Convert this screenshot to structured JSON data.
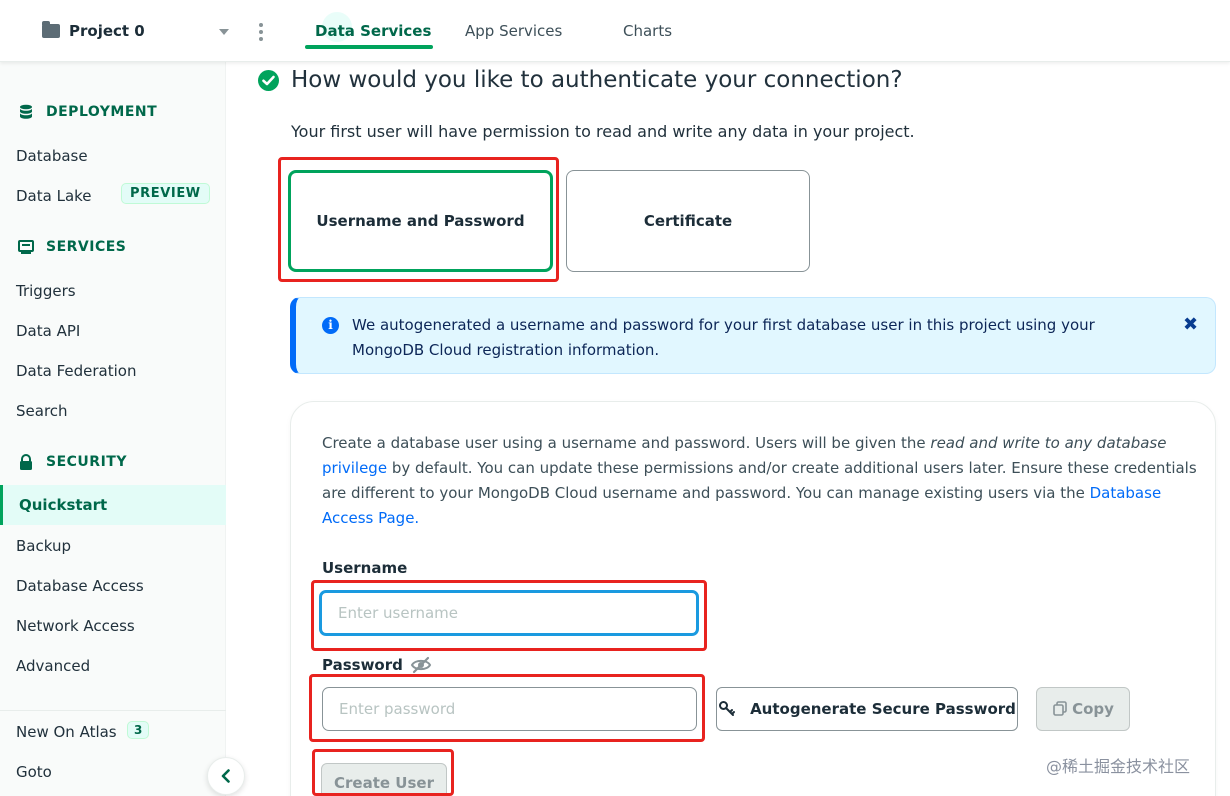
{
  "topbar": {
    "project_name": "Project 0",
    "tabs": [
      {
        "label": "Data Services",
        "active": true
      },
      {
        "label": "App Services",
        "active": false
      },
      {
        "label": "Charts",
        "active": false
      }
    ]
  },
  "sidebar": {
    "sections": [
      {
        "title": "DEPLOYMENT",
        "icon": "database-icon",
        "items": [
          "Database",
          "Data Lake"
        ]
      },
      {
        "title": "SERVICES",
        "icon": "services-icon",
        "items": [
          "Triggers",
          "Data API",
          "Data Federation",
          "Search"
        ]
      },
      {
        "title": "SECURITY",
        "icon": "lock-icon",
        "items": [
          "Quickstart",
          "Backup",
          "Database Access",
          "Network Access",
          "Advanced"
        ]
      }
    ],
    "preview_badge": "PREVIEW",
    "active_item": "Quickstart",
    "footer": {
      "new_on_atlas": "New On Atlas",
      "new_count": "3",
      "goto": "Goto"
    }
  },
  "main": {
    "heading": "How would you like to authenticate your connection?",
    "subtext": "Your first user will have permission to read and write any data in your project.",
    "options": [
      "Username and Password",
      "Certificate"
    ],
    "selected_option": "Username and Password",
    "banner": {
      "text": "We autogenerated a username and password for your first database user in this project using your MongoDB Cloud registration information.",
      "info_glyph": "i",
      "close_glyph": "✖"
    },
    "form": {
      "intro_1": "Create a database user using a username and password. Users will be given the ",
      "intro_italic": "read and write to any database",
      "intro_link_1": "privilege",
      "intro_2": " by default. You can update these permissions and/or create additional users later. Ensure these credentials are different to your MongoDB Cloud username and password. You can manage existing users via the ",
      "intro_link_2": "Database Access Page.",
      "username_label": "Username",
      "username_placeholder": "Enter username",
      "password_label": "Password",
      "password_placeholder": "Enter password",
      "autogen_button": "Autogenerate Secure Password",
      "copy_button": "Copy",
      "create_button": "Create User"
    }
  },
  "watermark": "@稀土掘金技术社区",
  "colors": {
    "brand_green": "#00a35c",
    "dark_green": "#00684a",
    "link_blue": "#016bf8",
    "annotation_red": "#e8231f"
  }
}
